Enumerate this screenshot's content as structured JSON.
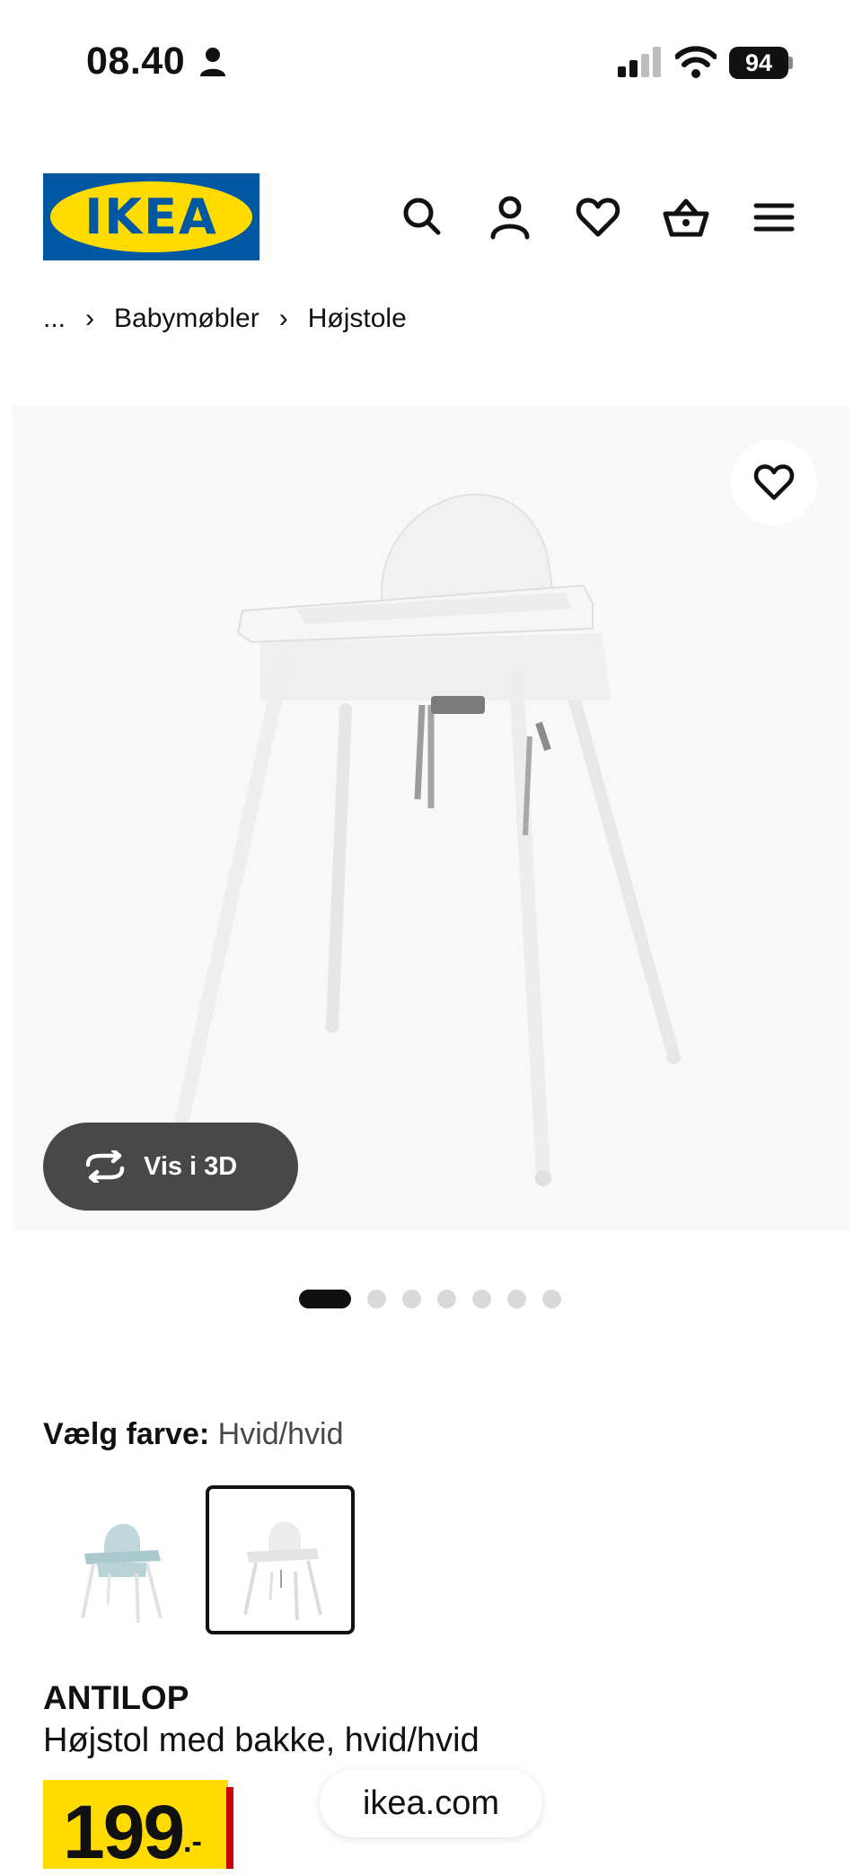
{
  "status_bar": {
    "time": "08.40",
    "battery": "94"
  },
  "header": {
    "logo_text": "IKEA",
    "icons": [
      "search-icon",
      "account-icon",
      "heart-icon",
      "basket-icon",
      "menu-icon"
    ]
  },
  "breadcrumb": {
    "ellipsis": "...",
    "items": [
      "Babymøbler",
      "Højstole"
    ]
  },
  "gallery": {
    "view_3d_label": "Vis i 3D",
    "dot_count": 7,
    "active_dot": 0
  },
  "color_selector": {
    "label": "Vælg farve:",
    "value": "Hvid/hvid",
    "selected_index": 1
  },
  "product": {
    "name": "ANTILOP",
    "description": "Højstol med bakke, hvid/hvid",
    "price": "199",
    "price_suffix": ".-"
  },
  "browser": {
    "url": "ikea.com"
  },
  "colors": {
    "ikea_blue": "#0058a3",
    "ikea_yellow": "#ffdb00",
    "price_red": "#cc0008"
  }
}
